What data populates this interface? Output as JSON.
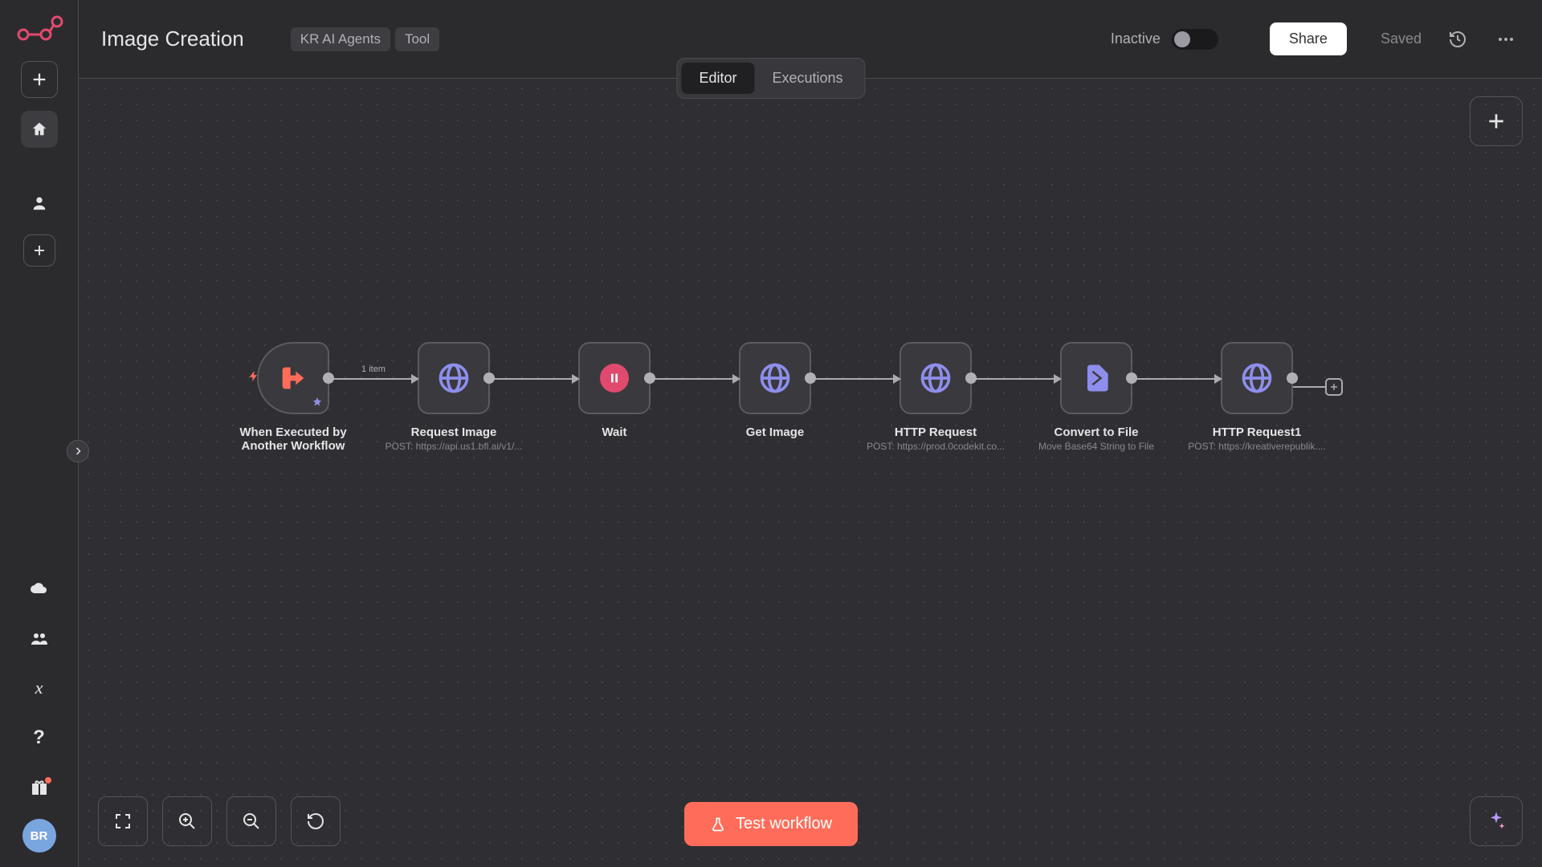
{
  "header": {
    "title": "Image Creation",
    "tags": [
      "KR AI Agents",
      "Tool"
    ],
    "status_label": "Inactive",
    "share_label": "Share",
    "saved_label": "Saved"
  },
  "tabs": {
    "editor": "Editor",
    "executions": "Executions",
    "active": "editor"
  },
  "sidebar": {
    "avatar": "BR"
  },
  "flow": {
    "edge_label": "1 item",
    "nodes": [
      {
        "title": "When Executed by Another Workflow",
        "sub": ""
      },
      {
        "title": "Request Image",
        "sub": "POST: https://api.us1.bfl.ai/v1/..."
      },
      {
        "title": "Wait",
        "sub": ""
      },
      {
        "title": "Get Image",
        "sub": ""
      },
      {
        "title": "HTTP Request",
        "sub": "POST: https://prod.0codekit.co..."
      },
      {
        "title": "Convert to File",
        "sub": "Move Base64 String to File"
      },
      {
        "title": "HTTP Request1",
        "sub": "POST: https://kreativerepublik...."
      }
    ]
  },
  "buttons": {
    "test_workflow": "Test workflow"
  }
}
